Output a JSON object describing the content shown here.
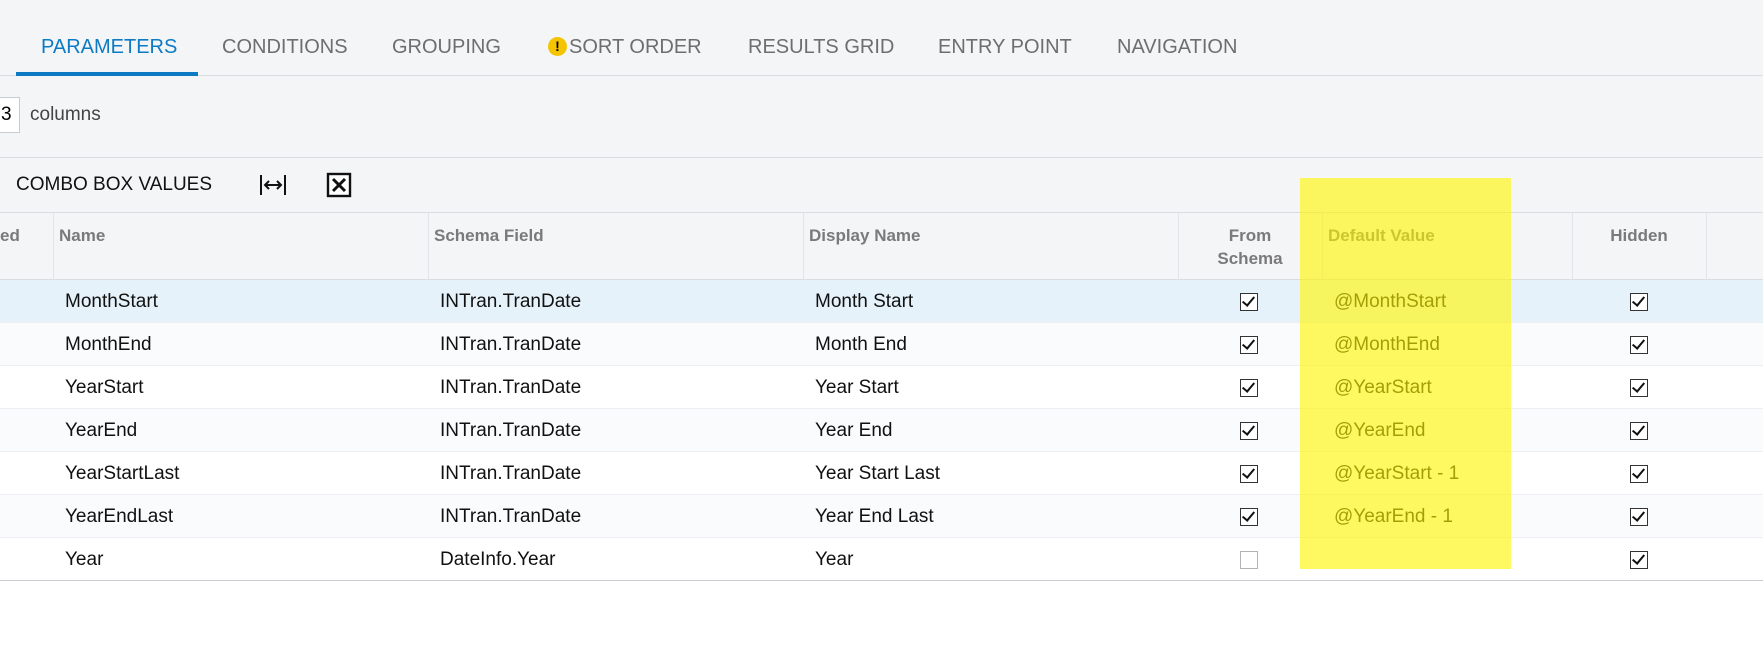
{
  "tabs": [
    {
      "label": "PARAMETERS",
      "active": true
    },
    {
      "label": "CONDITIONS"
    },
    {
      "label": "GROUPING"
    },
    {
      "label": "SORT ORDER",
      "icon": "warning-icon",
      "icon_glyph": "!"
    },
    {
      "label": "RESULTS GRID"
    },
    {
      "label": "ENTRY POINT"
    },
    {
      "label": "NAVIGATION"
    }
  ],
  "columns_setting": {
    "value": "3",
    "label": "columns"
  },
  "toolbar": {
    "combo_label": "COMBO BOX VALUES",
    "fit_icon": "fit-columns-icon",
    "excel_icon": "export-excel-icon"
  },
  "grid": {
    "headers": {
      "required_partial": "ed",
      "name": "Name",
      "schema_field": "Schema Field",
      "display_name": "Display Name",
      "from_schema_line1": "From",
      "from_schema_line2": "Schema",
      "default_value": "Default Value",
      "hidden": "Hidden"
    },
    "rows": [
      {
        "name": "MonthStart",
        "schema_field": "INTran.TranDate",
        "display_name": "Month Start",
        "from_schema": true,
        "default_value": "@MonthStart",
        "hidden": true
      },
      {
        "name": "MonthEnd",
        "schema_field": "INTran.TranDate",
        "display_name": "Month End",
        "from_schema": true,
        "default_value": "@MonthEnd",
        "hidden": true
      },
      {
        "name": "YearStart",
        "schema_field": "INTran.TranDate",
        "display_name": "Year Start",
        "from_schema": true,
        "default_value": "@YearStart",
        "hidden": true
      },
      {
        "name": "YearEnd",
        "schema_field": "INTran.TranDate",
        "display_name": "Year End",
        "from_schema": true,
        "default_value": "@YearEnd",
        "hidden": true
      },
      {
        "name": "YearStartLast",
        "schema_field": "INTran.TranDate",
        "display_name": "Year Start Last",
        "from_schema": true,
        "default_value": "@YearStart - 1",
        "hidden": true
      },
      {
        "name": "YearEndLast",
        "schema_field": "INTran.TranDate",
        "display_name": "Year End Last",
        "from_schema": true,
        "default_value": "@YearEnd - 1",
        "hidden": true
      },
      {
        "name": "Year",
        "schema_field": "DateInfo.Year",
        "display_name": "Year",
        "from_schema": false,
        "default_value": "",
        "hidden": true
      }
    ]
  },
  "colors": {
    "accent": "#0c7bc4",
    "highlight": "#fff500",
    "warning": "#f5c400"
  }
}
